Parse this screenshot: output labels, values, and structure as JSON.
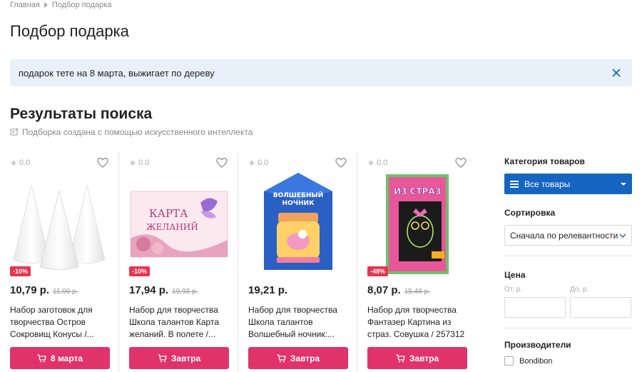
{
  "breadcrumb": {
    "home": "Главная",
    "current": "Подбор подарка"
  },
  "page_title": "Подбор подарка",
  "query": {
    "text": "подарок тете на 8 марта, выжигает по дереву"
  },
  "results": {
    "title": "Результаты поиска",
    "ai_note": "Подборка создана с помощью искусственного интеллекта"
  },
  "products": [
    {
      "rating": "0.0",
      "badge": "-10%",
      "price": "10,79 р.",
      "old_price": "11,99 р.",
      "name": "Набор заготовок для творчества Остров Сокровищ Конусы /...",
      "button": "8 марта",
      "image_icon": "foam-cones-image"
    },
    {
      "rating": "0.0",
      "badge": "-10%",
      "price": "17,94 р.",
      "old_price": "19,93 р.",
      "name": "Набор для творчества Школа талантов Карта желаний. В полете /...",
      "button": "Завтра",
      "image_icon": "wish-card-box-image"
    },
    {
      "rating": "0.0",
      "badge": "",
      "price": "19,21 р.",
      "old_price": "",
      "name": "Набор для творчества Школа талантов Волшебный ночник:...",
      "button": "Завтра",
      "image_icon": "night-light-box-image"
    },
    {
      "rating": "0.0",
      "badge": "-48%",
      "price": "8,07 р.",
      "old_price": "15,48 р.",
      "name": "Набор для творчества Фантазер Картина из страз. Совушка / 257312",
      "button": "Завтра",
      "image_icon": "rhinestone-owl-box-image"
    }
  ],
  "img_text": {
    "card": "КАРТА",
    "wishes": "ЖЕЛАНИЙ",
    "magic": "ВОЛШЕБНЫЙ",
    "night": "НОЧНИК",
    "strass": "ИЗ СТРАЗ"
  },
  "sidebar": {
    "category_title": "Категория товаров",
    "category_value": "Все товары",
    "sort_title": "Сортировка",
    "sort_value": "Сначала по релевантности",
    "price_title": "Цена",
    "price_from": "От, р.",
    "price_to": "До, р.",
    "brands_title": "Производители",
    "brands": [
      "Bondibon"
    ]
  },
  "colors": {
    "accent_blue": "#1565c0",
    "buy_pink": "#e0336b",
    "discount_red": "#e63550",
    "query_bg": "#e8f1fa"
  }
}
